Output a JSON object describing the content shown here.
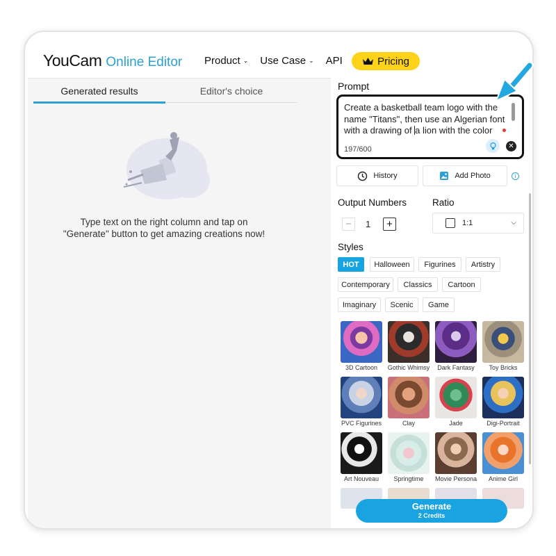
{
  "header": {
    "logo_main": "YouCam",
    "logo_sub": "Online Editor",
    "menu": [
      "Product",
      "Use Case",
      "API"
    ],
    "pricing": "Pricing"
  },
  "left": {
    "tabs": [
      "Generated results",
      "Editor's choice"
    ],
    "empty_text_1": "Type text on the right column and tap on",
    "empty_text_2": "\"Generate\" button to get amazing creations now!"
  },
  "prompt": {
    "label": "Prompt",
    "text_before_caret": "Create a basketball team logo with the name \"Titans\", then use an Algerian font with a drawing of ",
    "text_after_caret": "a lion with the color",
    "counter": "197/600"
  },
  "actions": {
    "history": "History",
    "add_photo": "Add Photo"
  },
  "output": {
    "label": "Output Numbers",
    "value": "1",
    "ratio_label": "Ratio",
    "ratio_value": "1:1"
  },
  "styles": {
    "label": "Styles",
    "chips": [
      "HOT",
      "Halloween",
      "Figurines",
      "Artistry",
      "Contemporary",
      "Classics",
      "Cartoon",
      "Imaginary",
      "Scenic",
      "Game"
    ],
    "active": "HOT",
    "thumbnails": [
      "3D Cartoon",
      "Gothic Whimsy",
      "Dark Fantasy",
      "Toy Bricks",
      "PVC Figurines",
      "Clay",
      "Jade",
      "Digi-Portrait",
      "Art Nouveau",
      "Springtime",
      "Movie Persona",
      "Anime Girl"
    ]
  },
  "generate": {
    "label": "Generate",
    "credits": "2 Credits"
  },
  "colors": {
    "accent": "#19a3e0",
    "pricing": "#ffd21a"
  }
}
